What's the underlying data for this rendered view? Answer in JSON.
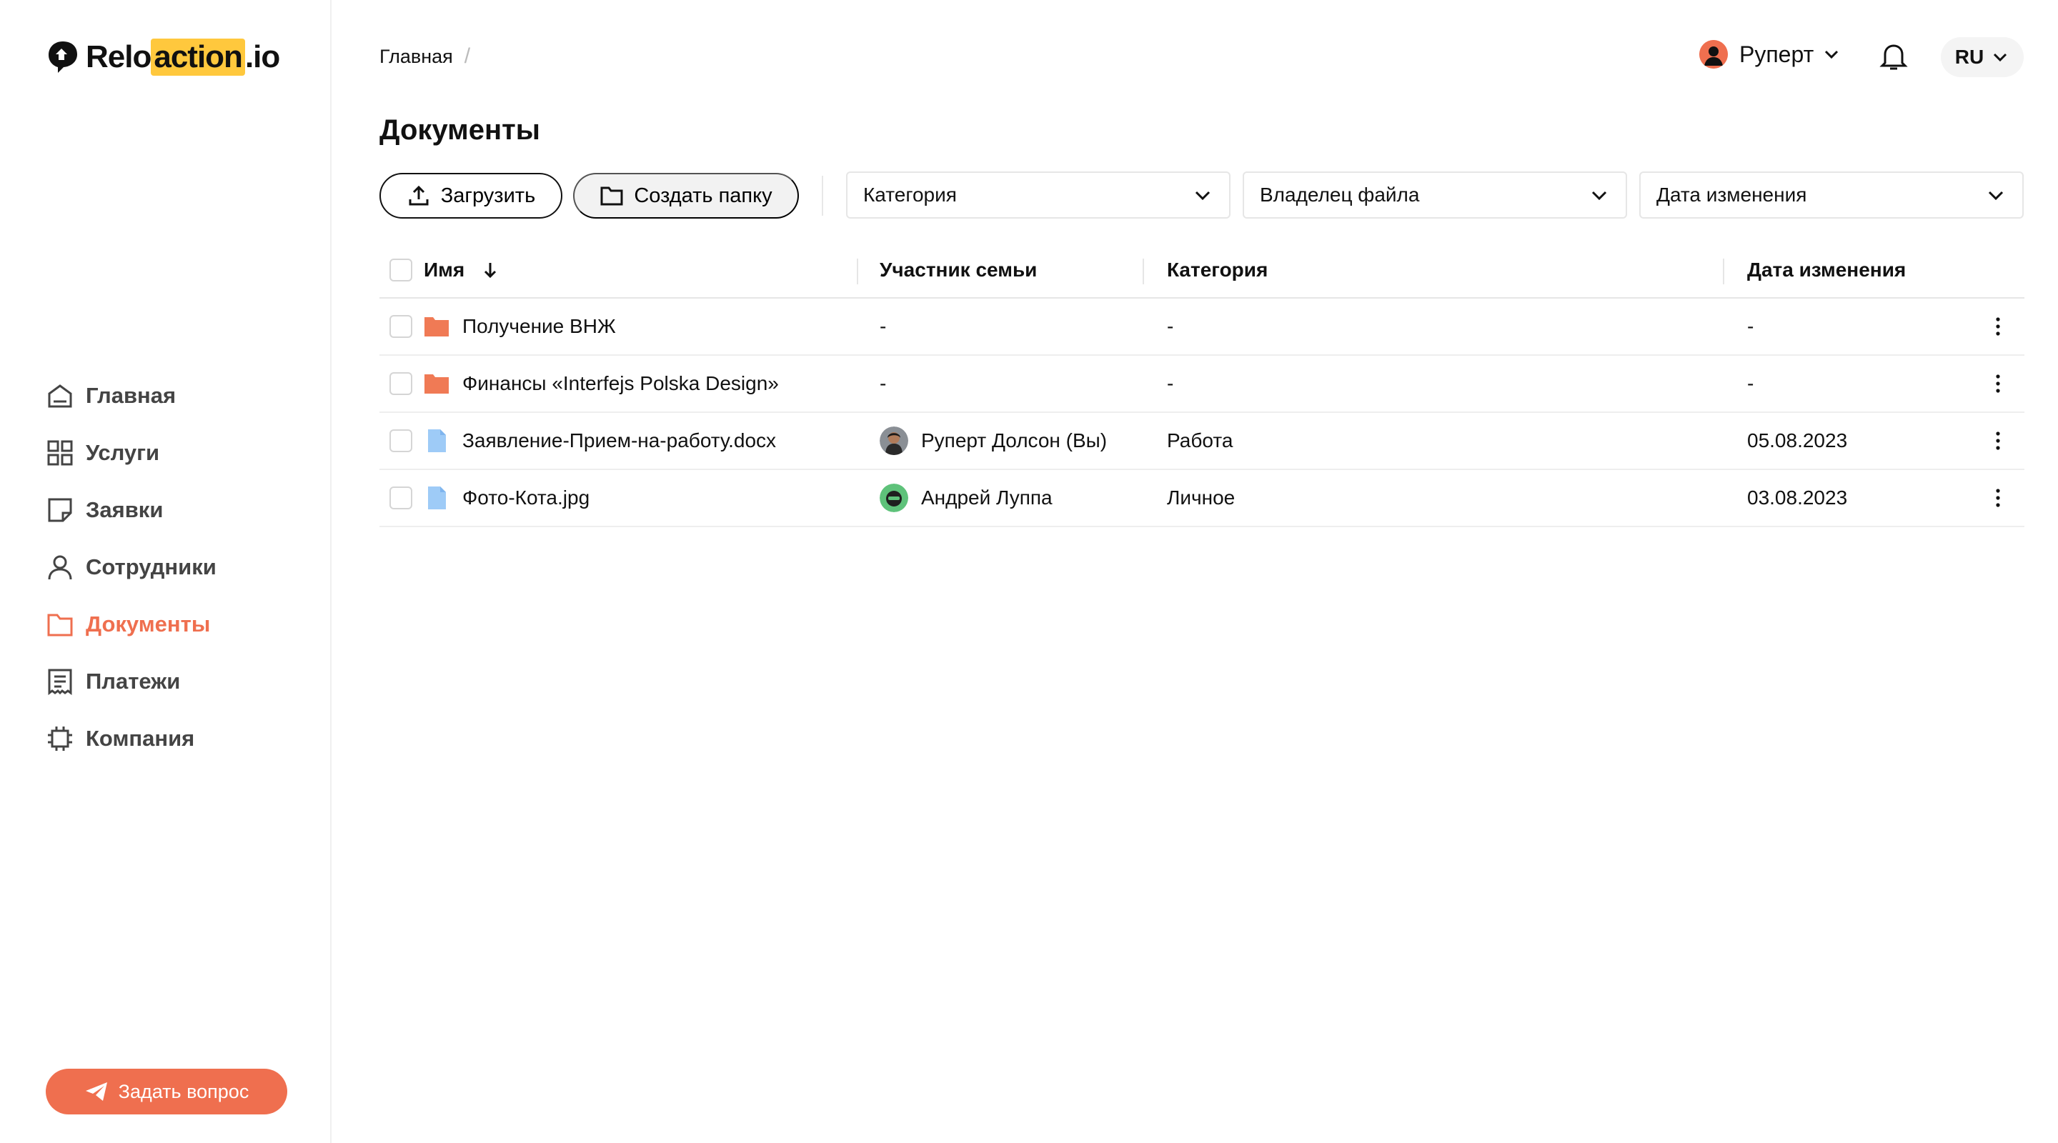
{
  "brand": {
    "logo_part1": "Relo",
    "logo_highlight": "action",
    "logo_part2": ".io",
    "accent_color": "#ef6f4f",
    "highlight_color": "#ffc83d"
  },
  "sidebar": {
    "items": [
      {
        "label": "Главная",
        "icon": "home-icon",
        "active": false
      },
      {
        "label": "Услуги",
        "icon": "grid-icon",
        "active": false
      },
      {
        "label": "Заявки",
        "icon": "note-icon",
        "active": false
      },
      {
        "label": "Сотрудники",
        "icon": "user-icon",
        "active": false
      },
      {
        "label": "Документы",
        "icon": "folder-icon",
        "active": true
      },
      {
        "label": "Платежи",
        "icon": "receipt-icon",
        "active": false
      },
      {
        "label": "Компания",
        "icon": "chip-icon",
        "active": false
      }
    ],
    "ask_button": "Задать вопрос"
  },
  "header": {
    "breadcrumb": "Главная",
    "breadcrumb_sep": "/",
    "user_name": "Руперт",
    "language": "RU"
  },
  "page": {
    "title": "Документы"
  },
  "toolbar": {
    "upload_label": "Загрузить",
    "create_folder_label": "Создать папку",
    "filters": [
      "Категория",
      "Владелец файла",
      "Дата изменения"
    ]
  },
  "table": {
    "columns": {
      "name": "Имя",
      "member": "Участник семьи",
      "category": "Категория",
      "date": "Дата изменения"
    },
    "rows": [
      {
        "type": "folder",
        "name": "Получение ВНЖ",
        "member": "-",
        "category": "-",
        "date": "-"
      },
      {
        "type": "folder",
        "name": "Финансы «Interfejs Polska Design»",
        "member": "-",
        "category": "-",
        "date": "-"
      },
      {
        "type": "file",
        "name": "Заявление-Прием-на-работу.docx",
        "member": "Руперт Долсон (Вы)",
        "category": "Работа",
        "date": "05.08.2023"
      },
      {
        "type": "file",
        "name": "Фото-Кота.jpg",
        "member": "Андрей Луппа",
        "category": "Личное",
        "date": "03.08.2023"
      }
    ]
  }
}
